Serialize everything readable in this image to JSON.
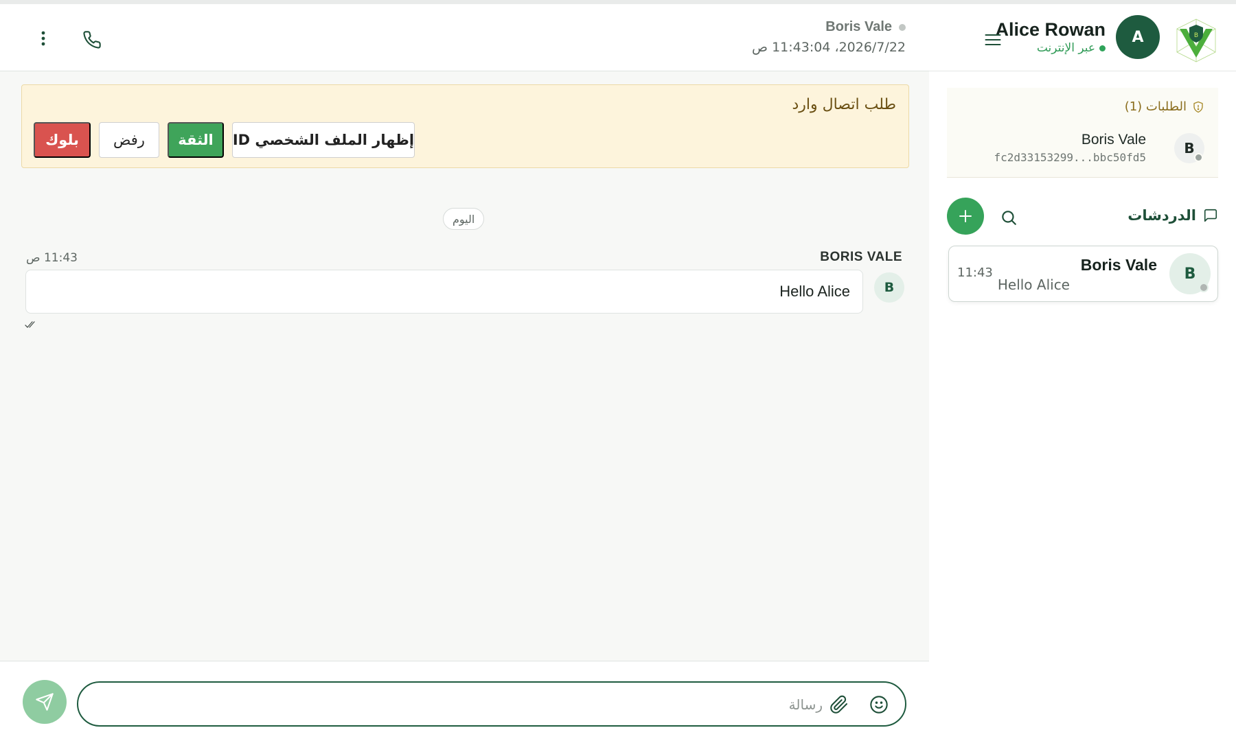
{
  "user": {
    "name": "Alice Rowan",
    "initial": "A",
    "status": "عبر الإنترنت"
  },
  "requests": {
    "title": "الطلبات (1)",
    "items": [
      {
        "name": "Boris Vale",
        "initial": "B",
        "id": "fc2d33153299...bbc50fd5"
      }
    ]
  },
  "chats": {
    "title": "الدردشات",
    "items": [
      {
        "name": "Boris Vale",
        "initial": "B",
        "preview": "Hello Alice",
        "time": "11:43"
      }
    ]
  },
  "conversation": {
    "peer_name": "Boris Vale",
    "peer_time": "2026/7/22، 11:43:04 ص",
    "banner": {
      "title": "طلب اتصال وارد",
      "show_profile": "إظهار الملف الشخصي ID",
      "trust": "الثقة",
      "reject": "رفض",
      "block": "بلوك"
    },
    "day_label": "اليوم",
    "messages": [
      {
        "sender": "BORIS VALE",
        "initial": "B",
        "text": "Hello Alice",
        "time": "11:43 ص"
      }
    ]
  },
  "composer": {
    "placeholder": "رسالة",
    "value": ""
  },
  "colors": {
    "brand": "#1e5b3f",
    "accent": "#3fa45a",
    "danger": "#d9534f",
    "banner_bg": "#fdf4dc"
  },
  "icons": {
    "logo": "shield-v-logo-icon",
    "menu": "hamburger-menu-icon",
    "requests": "shield-icon",
    "chats": "chat-bubble-icon",
    "search": "search-icon",
    "add": "plus-icon",
    "call": "phone-icon",
    "more": "more-vertical-icon",
    "send": "send-icon",
    "attach": "paperclip-icon",
    "emoji": "smiley-icon",
    "read": "double-check-icon"
  }
}
